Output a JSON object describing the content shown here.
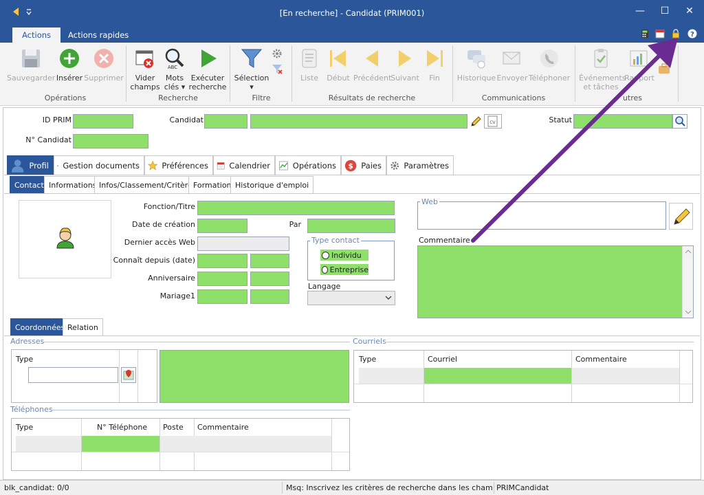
{
  "window": {
    "title": "[En recherche] - Candidat (PRIM001)",
    "min_glyph": "—",
    "max_glyph": "☐",
    "close_glyph": "✕"
  },
  "tabs": {
    "actions": "Actions",
    "quick": "Actions rapides"
  },
  "ribbon": {
    "save": "Sauvegarder",
    "insert": "Insérer",
    "delete": "Supprimer",
    "group_ops": "Opérations",
    "clear1": "Vider",
    "clear2": "champs",
    "keys1": "Mots",
    "keys2": "clés ▾",
    "exec1": "Exécuter",
    "exec2": "recherche",
    "group_search": "Recherche",
    "selection": "Sélection",
    "selection_arrow": "▾",
    "group_filter": "Filtre",
    "list": "Liste",
    "first": "Début",
    "prev": "Précédent",
    "next": "Suivant",
    "end": "Fin",
    "group_results": "Résultats de recherche",
    "history": "Historique",
    "send": "Envoyer",
    "phone": "Téléphoner",
    "group_comm": "Communications",
    "events1": "Événements",
    "events2": "et tâches",
    "report": "Rapport",
    "group_other": "utres"
  },
  "header": {
    "id_label": "ID PRIM",
    "cand_label": "Candidat",
    "status_label": "Statut",
    "num_label": "N° Candidat"
  },
  "ptabs": [
    "Profil",
    "Gestion documents",
    "Préférences",
    "Calendrier",
    "Opérations",
    "Paies",
    "Paramètres"
  ],
  "stabs": [
    "Contact",
    "Informations",
    "Infos/Classement/Critères",
    "Formation",
    "Historique d'emploi"
  ],
  "form": {
    "function": "Fonction/Titre",
    "created": "Date de création",
    "by": "Par",
    "last_web": "Dernier accès Web",
    "known": "Connaît depuis (date)",
    "birthday": "Anniversaire",
    "marriage": "Mariage1",
    "type_contact": "Type contact",
    "individual": "Individu",
    "company": "Entreprise",
    "language": "Langage",
    "web": "Web",
    "comment": "Commentaire"
  },
  "ctabs": [
    "Coordonnées",
    "Relation"
  ],
  "addresses": {
    "title": "Adresses",
    "type": "Type"
  },
  "emails": {
    "title": "Courriels",
    "cols": [
      "Type",
      "Courriel",
      "Commentaire"
    ]
  },
  "phones": {
    "title": "Téléphones",
    "cols": [
      "Type",
      "N° Téléphone",
      "Poste",
      "Commentaire"
    ]
  },
  "status": {
    "left": "blk_candidat: 0/0",
    "msg": "Msq: Inscrivez les critères de recherche dans les champs v",
    "right": "PRIMCandidat"
  },
  "colors": {
    "accent": "#2b579a",
    "field_green": "#8ee06a",
    "arrow": "#6a2c91"
  }
}
